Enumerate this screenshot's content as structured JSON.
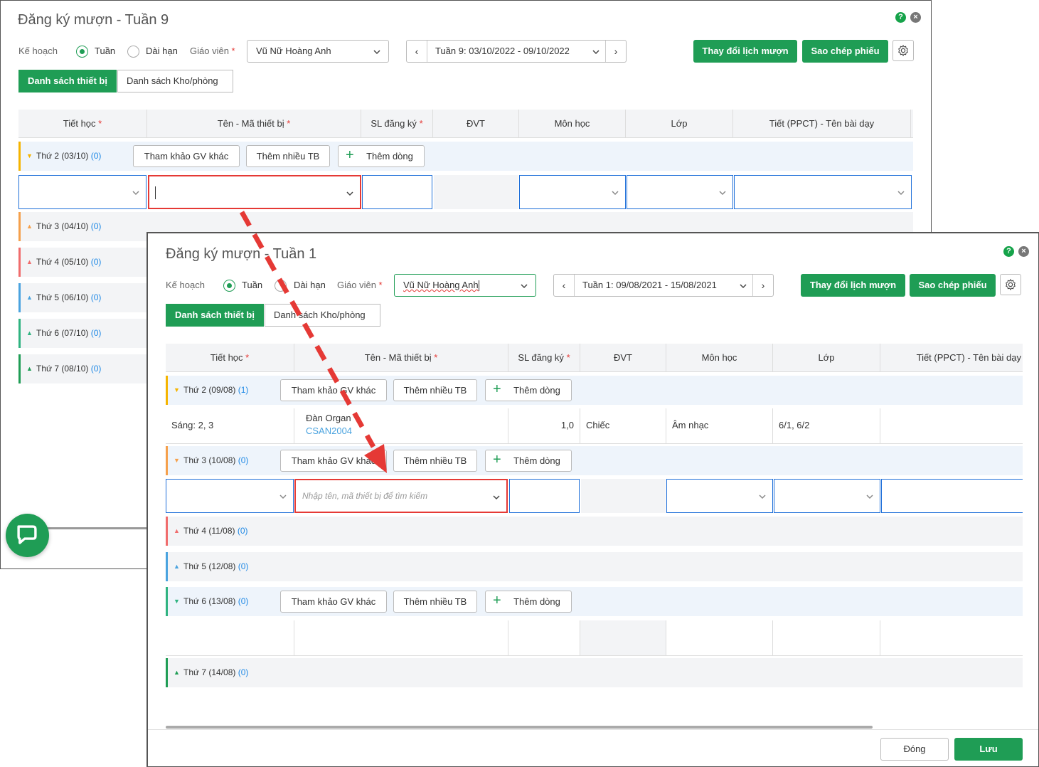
{
  "back": {
    "title": "Đăng ký mượn - Tuần 9",
    "plan_label": "Kế hoạch",
    "radio_week": "Tuần",
    "radio_long": "Dài hạn",
    "teacher_label": "Giáo viên",
    "teacher_value": "Vũ Nữ Hoàng Anh",
    "week_value": "Tuần 9: 03/10/2022 - 09/10/2022",
    "btn_change": "Thay đổi lịch mượn",
    "btn_copy": "Sao chép phiếu",
    "tab_devices": "Danh sách thiết bị",
    "tab_rooms": "Danh sách Kho/phòng",
    "columns": [
      "Tiết học",
      "Tên - Mã thiết bị",
      "SL đăng ký",
      "ĐVT",
      "Môn học",
      "Lớp",
      "Tiết (PPCT) - Tên bài dạy"
    ],
    "days": [
      {
        "label": "Thứ 2 (03/10)",
        "count": "(0)",
        "color": "#f5b400"
      },
      {
        "label": "Thứ 3 (04/10)",
        "count": "(0)",
        "color": "#f5a04b"
      },
      {
        "label": "Thứ 4 (05/10)",
        "count": "(0)",
        "color": "#f06c6c"
      },
      {
        "label": "Thứ 5 (06/10)",
        "count": "(0)",
        "color": "#4aa3df"
      },
      {
        "label": "Thứ 6 (07/10)",
        "count": "(0)",
        "color": "#2fb380"
      },
      {
        "label": "Thứ 7 (08/10)",
        "count": "(0)",
        "color": "#1f9d55"
      }
    ],
    "btn_ref": "Tham khảo GV khác",
    "btn_multi": "Thêm nhiều TB",
    "btn_add": "Thêm dòng"
  },
  "front": {
    "title": "Đăng ký mượn - Tuần 1",
    "plan_label": "Kế hoạch",
    "radio_week": "Tuần",
    "radio_long": "Dài hạn",
    "teacher_label": "Giáo viên",
    "teacher_value": "Vũ Nữ Hoàng Anh",
    "week_value": "Tuần 1: 09/08/2021 - 15/08/2021",
    "btn_change": "Thay đổi lịch mượn",
    "btn_copy": "Sao chép phiếu",
    "tab_devices": "Danh sách thiết bị",
    "tab_rooms": "Danh sách Kho/phòng",
    "columns": [
      "Tiết học",
      "Tên - Mã thiết bị",
      "SL đăng ký",
      "ĐVT",
      "Môn học",
      "Lớp",
      "Tiết (PPCT) - Tên bài dạy"
    ],
    "days": [
      {
        "label": "Thứ 2 (09/08)",
        "count": "(1)",
        "color": "#f5b400"
      },
      {
        "label": "Thứ 3 (10/08)",
        "count": "(0)",
        "color": "#f5a04b"
      },
      {
        "label": "Thứ 4 (11/08)",
        "count": "(0)",
        "color": "#f06c6c"
      },
      {
        "label": "Thứ 5 (12/08)",
        "count": "(0)",
        "color": "#4aa3df"
      },
      {
        "label": "Thứ 6 (13/08)",
        "count": "(0)",
        "color": "#2fb380"
      },
      {
        "label": "Thứ 7 (14/08)",
        "count": "(0)",
        "color": "#1f9d55"
      }
    ],
    "btn_ref": "Tham khảo GV khác",
    "btn_multi": "Thêm nhiều TB",
    "btn_add": "Thêm dòng",
    "row": {
      "period": "Sáng: 2, 3",
      "device_name": "Đàn Organ",
      "device_code": "CSAN2004",
      "qty": "1,0",
      "unit": "Chiếc",
      "subject": "Âm nhạc",
      "class": "6/1, 6/2"
    },
    "search_placeholder": "Nhập tên, mã thiết bị để tìm kiếm",
    "btn_close": "Đóng",
    "btn_save": "Lưu"
  },
  "colors": {
    "accent": "#1f9d55",
    "highlight": "#e53935",
    "link": "#1e88e5"
  }
}
